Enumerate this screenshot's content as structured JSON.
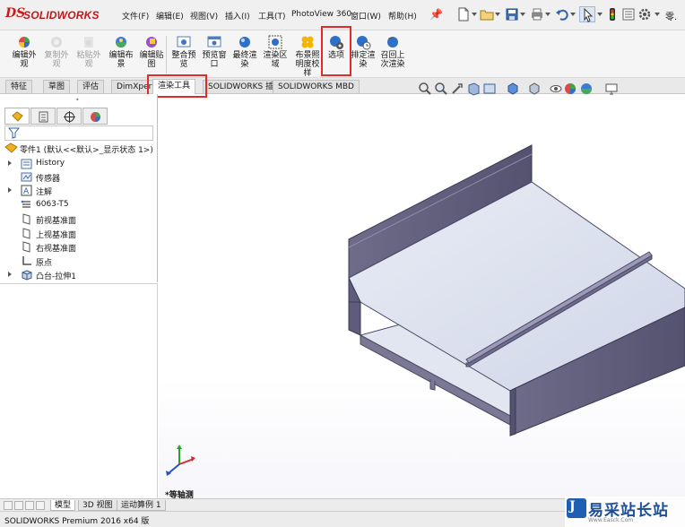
{
  "app": {
    "logo_ds": "DS",
    "logo_text": "SOLIDWORKS"
  },
  "menu": {
    "items": [
      "文件(F)",
      "编辑(E)",
      "视图(V)",
      "插入(I)",
      "工具(T)",
      "PhotoView 360",
      "窗口(W)",
      "帮助(H)"
    ],
    "more": "零."
  },
  "quick_access": {
    "icons": [
      "new-document-icon",
      "open-icon",
      "save-icon",
      "print-icon",
      "undo-icon",
      "select-icon",
      "rebuild-icon",
      "file-properties-icon",
      "options-icon"
    ]
  },
  "ribbon": {
    "buttons": [
      {
        "label": "编辑外\n观",
        "icon": "edit-appearance-icon",
        "enabled": true
      },
      {
        "label": "复制外\n观",
        "icon": "copy-appearance-icon",
        "enabled": false
      },
      {
        "label": "粘贴外\n观",
        "icon": "paste-appearance-icon",
        "enabled": false
      },
      {
        "label": "编辑布\n景",
        "icon": "edit-scene-icon",
        "enabled": true
      },
      {
        "label": "编辑贴\n图",
        "icon": "edit-decal-icon",
        "enabled": true
      },
      {
        "label": "整合预\n览",
        "icon": "integrated-preview-icon",
        "enabled": true
      },
      {
        "label": "预览窗\n口",
        "icon": "preview-window-icon",
        "enabled": true
      },
      {
        "label": "最终渲\n染",
        "icon": "final-render-icon",
        "enabled": true
      },
      {
        "label": "渲染区\n域",
        "icon": "render-region-icon",
        "enabled": true
      },
      {
        "label": "布景照\n明度校\n样",
        "icon": "scene-illumination-proof-icon",
        "enabled": true
      },
      {
        "label": "选项",
        "icon": "options-render-icon",
        "enabled": true
      },
      {
        "label": "排定渲\n染",
        "icon": "schedule-render-icon",
        "enabled": true
      },
      {
        "label": "召回上\n次渲染",
        "icon": "recall-last-render-icon",
        "enabled": true
      }
    ]
  },
  "command_tabs": [
    "特征",
    "草图",
    "评估",
    "DimXpert",
    "渲染工具",
    "SOLIDWORKS 插件",
    "SOLIDWORKS MBD"
  ],
  "active_command_tab": "渲染工具",
  "view_toolbar": {
    "icons": [
      "zoom-to-fit-icon",
      "zoom-area-icon",
      "previous-view-icon",
      "section-view-icon",
      "dynamic-annotation-icon",
      "view-orientation-icon",
      "display-style-icon",
      "hide-show-items-icon",
      "edit-appearance-icon",
      "apply-scene-icon",
      "view-settings-icon",
      "monitor-icon"
    ]
  },
  "feature_tree": {
    "panel_tabs": [
      "featuremanager-icon",
      "propertymanager-icon",
      "configurationmanager-icon",
      "displaymanager-icon"
    ],
    "root": "零件1  (默认<<默认>_显示状态 1>)",
    "items": [
      {
        "label": "History",
        "icon": "history-folder-icon",
        "expandable": true
      },
      {
        "label": "传感器",
        "icon": "sensors-icon",
        "expandable": false
      },
      {
        "label": "注解",
        "icon": "annotations-icon",
        "expandable": true
      },
      {
        "label": "6063-T5",
        "icon": "material-icon",
        "expandable": false
      },
      {
        "label": "前视基准面",
        "icon": "plane-icon",
        "expandable": false
      },
      {
        "label": "上视基准面",
        "icon": "plane-icon",
        "expandable": false
      },
      {
        "label": "右视基准面",
        "icon": "plane-icon",
        "expandable": false
      },
      {
        "label": "原点",
        "icon": "origin-icon",
        "expandable": false
      },
      {
        "label": "凸台-拉伸1",
        "icon": "boss-extrude-icon",
        "expandable": true
      }
    ]
  },
  "viewport": {
    "view_name": "*等轴测",
    "model_face_color": "#dfe3ef",
    "model_edge_color": "#4a4a66",
    "model_side_color": "#5a5a78"
  },
  "bottom_tabs": [
    "模型",
    "3D 视图",
    "运动算例 1"
  ],
  "active_bottom_tab": "模型",
  "status_bar": {
    "text": "SOLIDWORKS Premium 2016 x64 版"
  },
  "watermark": {
    "logo_glyph": "J",
    "title": "易采站长站",
    "url": "Www.Easck.Com"
  },
  "colors": {
    "highlight": "#e12b2b",
    "brand_red": "#c0181a",
    "accent_blue": "#2a7ad0"
  }
}
